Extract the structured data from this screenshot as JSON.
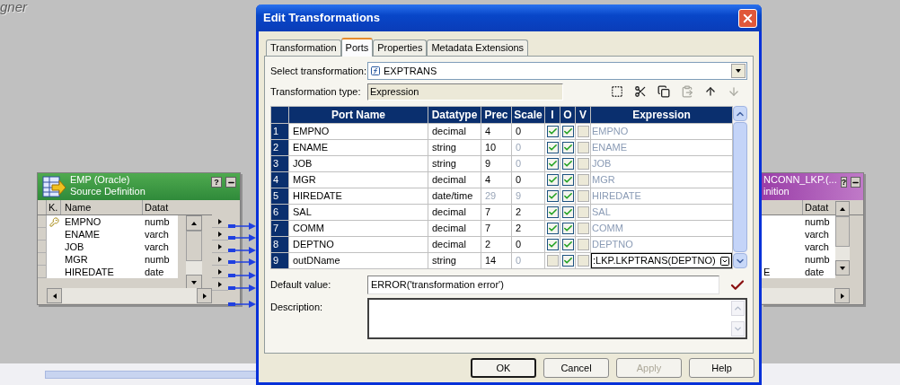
{
  "canvas_label": "gner",
  "source_node": {
    "title": "EMP (Oracle)",
    "subtitle": "Source Definition",
    "help": "?",
    "columns": [
      "K.",
      "Name",
      "Datat"
    ],
    "rows": [
      {
        "key": true,
        "name": "EMPNO",
        "datatype": "numb"
      },
      {
        "key": false,
        "name": "ENAME",
        "datatype": "varch"
      },
      {
        "key": false,
        "name": "JOB",
        "datatype": "varch"
      },
      {
        "key": false,
        "name": "MGR",
        "datatype": "numb"
      },
      {
        "key": false,
        "name": "HIREDATE",
        "datatype": "date"
      }
    ]
  },
  "target_node": {
    "title": "NCONN_LKP.(...",
    "subtitle": "inition",
    "help": "?",
    "column": "Datat",
    "rows": [
      {
        "datatype": "numb"
      },
      {
        "datatype": "varch"
      },
      {
        "datatype": "varch"
      },
      {
        "datatype": "numb"
      },
      {
        "name": "E",
        "datatype": "date"
      }
    ]
  },
  "dialog": {
    "title": "Edit Transformations",
    "tabs": [
      {
        "label": "Transformation",
        "selected": false
      },
      {
        "label": "Ports",
        "selected": true
      },
      {
        "label": "Properties",
        "selected": false
      },
      {
        "label": "Metadata Extensions",
        "selected": false
      }
    ],
    "select_label": "Select transformation:",
    "select_value": "EXPTRANS",
    "type_label": "Transformation type:",
    "type_value": "Expression",
    "toolbar": [
      {
        "kind": "new",
        "disabled": false
      },
      {
        "kind": "cut",
        "disabled": false
      },
      {
        "kind": "copy",
        "disabled": false
      },
      {
        "kind": "paste",
        "disabled": true
      },
      {
        "kind": "up",
        "disabled": false
      },
      {
        "kind": "down",
        "disabled": true
      }
    ],
    "columns": [
      "Port Name",
      "Datatype",
      "Prec",
      "Scale",
      "I",
      "O",
      "V",
      "Expression"
    ],
    "ports": [
      {
        "number": "1",
        "name": "EMPNO",
        "datatype": "decimal",
        "prec": "4",
        "prec_disabled": false,
        "scale": "0",
        "scale_disabled": false,
        "input": true,
        "output": true,
        "variable": false,
        "expression": "EMPNO",
        "expression_disabled": true,
        "editing": false
      },
      {
        "number": "2",
        "name": "ENAME",
        "datatype": "string",
        "prec": "10",
        "prec_disabled": false,
        "scale": "0",
        "scale_disabled": true,
        "input": true,
        "output": true,
        "variable": false,
        "expression": "ENAME",
        "expression_disabled": true,
        "editing": false
      },
      {
        "number": "3",
        "name": "JOB",
        "datatype": "string",
        "prec": "9",
        "prec_disabled": false,
        "scale": "0",
        "scale_disabled": true,
        "input": true,
        "output": true,
        "variable": false,
        "expression": "JOB",
        "expression_disabled": true,
        "editing": false
      },
      {
        "number": "4",
        "name": "MGR",
        "datatype": "decimal",
        "prec": "4",
        "prec_disabled": false,
        "scale": "0",
        "scale_disabled": false,
        "input": true,
        "output": true,
        "variable": false,
        "expression": "MGR",
        "expression_disabled": true,
        "editing": false
      },
      {
        "number": "5",
        "name": "HIREDATE",
        "datatype": "date/time",
        "prec": "29",
        "prec_disabled": true,
        "scale": "9",
        "scale_disabled": true,
        "input": true,
        "output": true,
        "variable": false,
        "expression": "HIREDATE",
        "expression_disabled": true,
        "editing": false
      },
      {
        "number": "6",
        "name": "SAL",
        "datatype": "decimal",
        "prec": "7",
        "prec_disabled": false,
        "scale": "2",
        "scale_disabled": false,
        "input": true,
        "output": true,
        "variable": false,
        "expression": "SAL",
        "expression_disabled": true,
        "editing": false
      },
      {
        "number": "7",
        "name": "COMM",
        "datatype": "decimal",
        "prec": "7",
        "prec_disabled": false,
        "scale": "2",
        "scale_disabled": false,
        "input": true,
        "output": true,
        "variable": false,
        "expression": "COMM",
        "expression_disabled": true,
        "editing": false
      },
      {
        "number": "8",
        "name": "DEPTNO",
        "datatype": "decimal",
        "prec": "2",
        "prec_disabled": false,
        "scale": "0",
        "scale_disabled": false,
        "input": true,
        "output": true,
        "variable": false,
        "expression": "DEPTNO",
        "expression_disabled": true,
        "editing": false
      },
      {
        "number": "9",
        "name": "outDName",
        "datatype": "string",
        "prec": "14",
        "prec_disabled": false,
        "scale": "0",
        "scale_disabled": true,
        "input": false,
        "output": true,
        "variable": false,
        "expression": ":LKP.LKPTRANS(DEPTNO)",
        "expression_disabled": false,
        "editing": true
      }
    ],
    "default_label": "Default value:",
    "default_value": "ERROR('transformation error')",
    "description_label": "Description:",
    "buttons": [
      {
        "label": "OK",
        "kind": "default",
        "disabled": false
      },
      {
        "label": "Cancel",
        "kind": "normal",
        "disabled": false
      },
      {
        "label": "Apply",
        "kind": "normal",
        "disabled": true
      },
      {
        "label": "Help",
        "kind": "normal",
        "disabled": false
      }
    ]
  }
}
